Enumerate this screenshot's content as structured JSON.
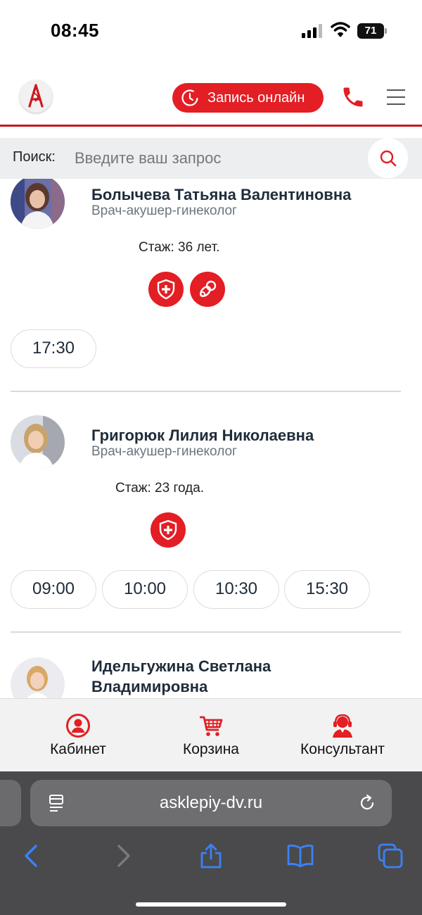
{
  "status_bar": {
    "time": "08:45",
    "battery": "71"
  },
  "header": {
    "booking_button": "Запись онлайн"
  },
  "search": {
    "label": "Поиск:",
    "placeholder": "Введите ваш запрос"
  },
  "doctors": [
    {
      "name": "Болычева Татьяна Валентиновна",
      "specialty": "Врач-акушер-гинеколог",
      "experience": "Стаж: 36 лет.",
      "badges": [
        "shield-cross-icon",
        "pacifier-icon"
      ],
      "slots": [
        "17:30"
      ]
    },
    {
      "name": "Григорюк Лилия Николаевна",
      "specialty": "Врач-акушер-гинеколог",
      "experience": "Стаж: 23 года.",
      "badges": [
        "shield-cross-icon"
      ],
      "slots": [
        "09:00",
        "10:00",
        "10:30",
        "15:30"
      ]
    },
    {
      "name": "Идельгужина Светлана Владимировна"
    }
  ],
  "bottom_nav": [
    {
      "label": "Кабинет",
      "icon": "user-circle-icon"
    },
    {
      "label": "Корзина",
      "icon": "cart-icon"
    },
    {
      "label": "Консультант",
      "icon": "consultant-icon"
    }
  ],
  "browser": {
    "url": "asklepiy-dv.ru"
  },
  "colors": {
    "accent": "#e31e24",
    "ios_blue": "#3a82f7"
  }
}
